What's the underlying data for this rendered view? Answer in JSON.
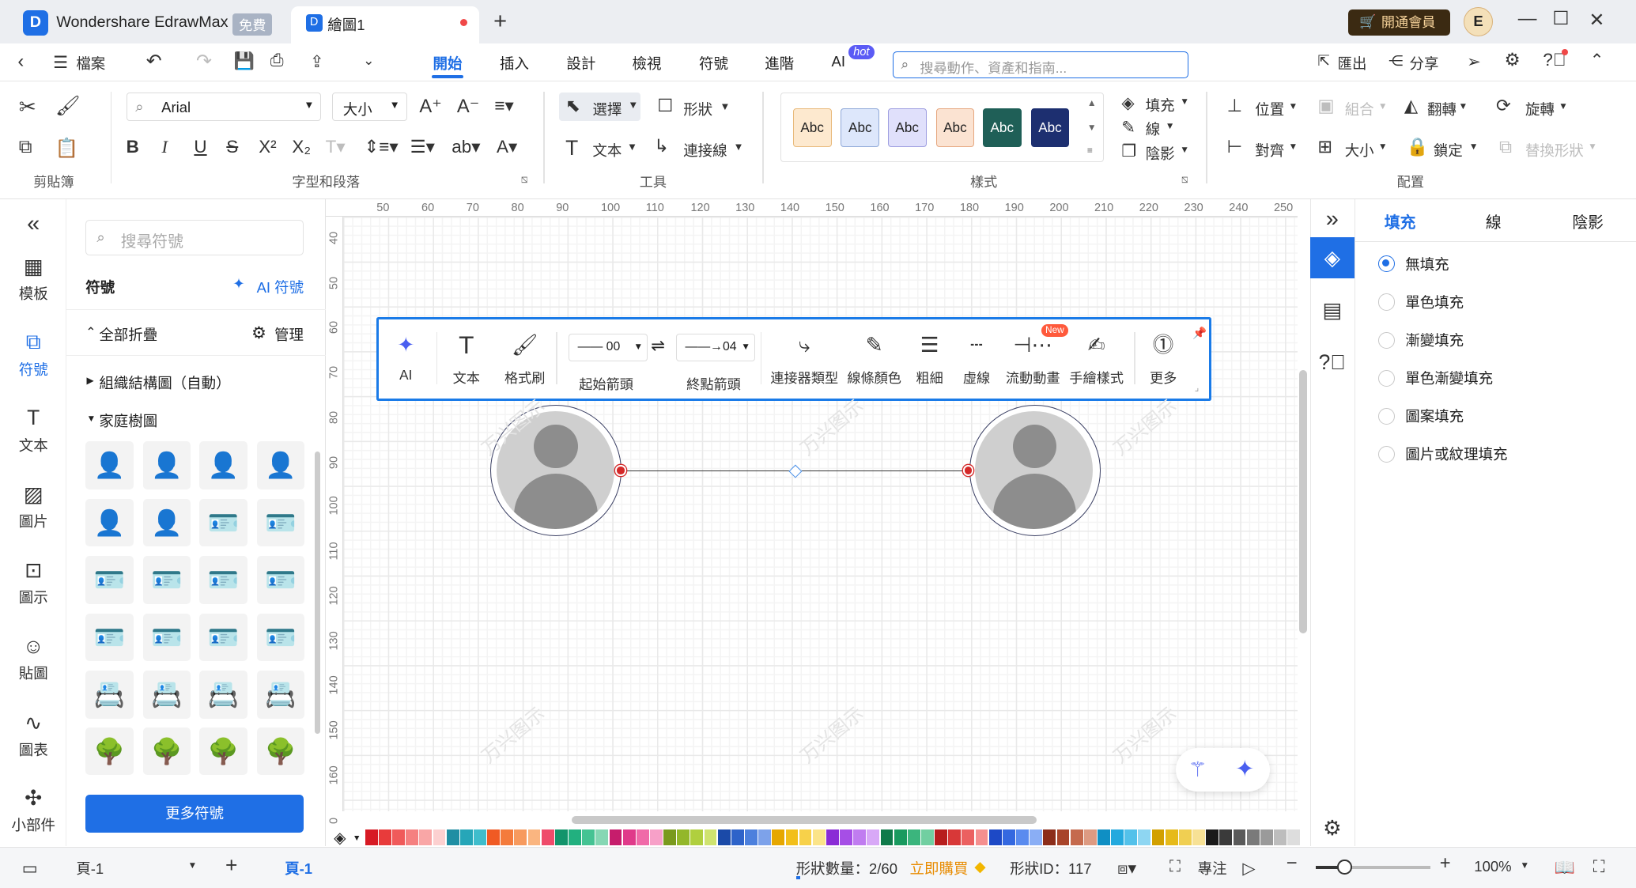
{
  "app": {
    "name": "Wondershare EdrawMax",
    "free_badge": "免費",
    "tab_title": "繪圖1",
    "vip_label": "開通會員",
    "avatar_initial": "E"
  },
  "menu": {
    "file": "檔案",
    "tabs": [
      "開始",
      "插入",
      "設計",
      "檢視",
      "符號",
      "進階",
      "AI"
    ],
    "hot": "hot",
    "search_placeholder": "搜尋動作、資產和指南...",
    "export": "匯出",
    "share": "分享"
  },
  "ribbon": {
    "font": "Arial",
    "size": "大小",
    "groups": {
      "clipboard": "剪貼簿",
      "font": "字型和段落",
      "tools": "工具",
      "style": "樣式",
      "arrange": "配置"
    },
    "select": "選擇",
    "shape": "形狀",
    "text": "文本",
    "connector": "連接線",
    "abc": "Abc",
    "fill": "填充",
    "line": "線",
    "shadow": "陰影",
    "position": "位置",
    "group": "組合",
    "flip": "翻轉",
    "rotate": "旋轉",
    "align": "對齊",
    "lock": "鎖定",
    "replace": "替換形狀"
  },
  "abc_colors": [
    {
      "bg": "#fde9cf",
      "border": "#e8b97a",
      "fg": "#222"
    },
    {
      "bg": "#dde7fb",
      "border": "#8fa8d8",
      "fg": "#222"
    },
    {
      "bg": "#e0e0fb",
      "border": "#9d9de0",
      "fg": "#222"
    },
    {
      "bg": "#fbe3d2",
      "border": "#e6a780",
      "fg": "#222"
    },
    {
      "bg": "#1f5f57",
      "border": "#1f5f57",
      "fg": "#fff"
    },
    {
      "bg": "#1d2f70",
      "border": "#1d2f70",
      "fg": "#fff"
    }
  ],
  "leftrail": [
    {
      "icon": "«",
      "label": ""
    },
    {
      "icon": "▦",
      "label": "模板"
    },
    {
      "icon": "⧉",
      "label": "符號"
    },
    {
      "icon": "T",
      "label": "文本"
    },
    {
      "icon": "▨",
      "label": "圖片"
    },
    {
      "icon": "⊡",
      "label": "圖示"
    },
    {
      "icon": "☺",
      "label": "貼圖"
    },
    {
      "icon": "∿",
      "label": "圖表"
    },
    {
      "icon": "✣",
      "label": "小部件"
    }
  ],
  "symbols": {
    "search_placeholder": "搜尋符號",
    "title": "符號",
    "ai": "AI 符號",
    "collapse_all": "全部折疊",
    "manage": "管理",
    "cat1": "組織結構圖（自動）",
    "cat2": "家庭樹圖",
    "more": "更多符號"
  },
  "ruler_h": [
    "50",
    "60",
    "70",
    "80",
    "90",
    "100",
    "110",
    "120",
    "130",
    "140",
    "150",
    "160",
    "170",
    "180",
    "190",
    "200",
    "210",
    "220",
    "230",
    "240",
    "250"
  ],
  "ruler_v": [
    "40",
    "50",
    "60",
    "70",
    "80",
    "90",
    "100",
    "110",
    "120",
    "130",
    "140",
    "150",
    "160",
    "0"
  ],
  "float_toolbar": {
    "ai": "AI",
    "text": "文本",
    "format": "格式刷",
    "start_arrow": "起始箭頭",
    "start_val": "00",
    "end_arrow": "終點箭頭",
    "end_val": "04",
    "connector_type": "連接器類型",
    "line_color": "線條顏色",
    "weight": "粗細",
    "dash": "虛線",
    "flow": "流動動畫",
    "new": "New",
    "hand": "手繪樣式",
    "more": "更多"
  },
  "watermark": "万兴图示",
  "right_panel": {
    "tabs": [
      "填充",
      "線",
      "陰影"
    ],
    "options": [
      "無填充",
      "單色填充",
      "漸變填充",
      "單色漸變填充",
      "圖案填充",
      "圖片或紋理填充"
    ],
    "selected": 0
  },
  "palette": [
    "#d71a24",
    "#e83b3b",
    "#f05a5a",
    "#f58080",
    "#f9a6a6",
    "#fcd0d0",
    "#1f8ea3",
    "#26a6b8",
    "#3fbdcc",
    "#f05a24",
    "#f47b3c",
    "#f79a5e",
    "#fab580",
    "#ef4b6b",
    "#12946b",
    "#22b07f",
    "#45c393",
    "#86d7b4",
    "#c61d6c",
    "#e03a8a",
    "#f06aa8",
    "#f7a0c8",
    "#7a9a1d",
    "#93b72a",
    "#b0cf3e",
    "#cfe36f",
    "#1b4aa8",
    "#2e63c9",
    "#4c80dd",
    "#7da2ea",
    "#e6a700",
    "#f2bf1a",
    "#f7d14a",
    "#fbe489",
    "#8a2bd6",
    "#a64ee6",
    "#c07cf0",
    "#d8a8f7",
    "#0f7a4a",
    "#199a5f",
    "#3bb57d",
    "#71cfa1",
    "#b71d1d",
    "#d83838",
    "#eb6060",
    "#f58f8f",
    "#1d49c6",
    "#3468e0",
    "#5a8bef",
    "#8aaef5",
    "#8c2d1a",
    "#a8442a",
    "#c56a4d",
    "#dd9a82",
    "#0f8fc4",
    "#23a9de",
    "#53c1ea",
    "#8ed6f2",
    "#d2a000",
    "#e6ba19",
    "#f0cf52",
    "#f7e195",
    "#1a1a1a",
    "#3a3a3a",
    "#5a5a5a",
    "#7a7a7a",
    "#9a9a9a",
    "#bdbdbd",
    "#dddddd"
  ],
  "status": {
    "page_sel": "頁-1",
    "page_tab": "頁-1",
    "shape_count": "形狀數量：2/60",
    "buy": "立即購買",
    "shape_id": "形狀ID：117",
    "focus": "專注",
    "zoom": "100%"
  }
}
